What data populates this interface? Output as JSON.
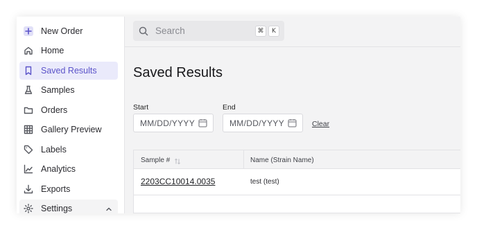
{
  "sidebar": {
    "items": [
      {
        "label": "New Order",
        "icon": "plus-icon"
      },
      {
        "label": "Home",
        "icon": "home-icon"
      },
      {
        "label": "Saved Results",
        "icon": "bookmark-icon",
        "active": true
      },
      {
        "label": "Samples",
        "icon": "flask-icon"
      },
      {
        "label": "Orders",
        "icon": "folder-icon"
      },
      {
        "label": "Gallery Preview",
        "icon": "grid-icon"
      },
      {
        "label": "Labels",
        "icon": "tag-icon"
      },
      {
        "label": "Analytics",
        "icon": "chart-icon"
      },
      {
        "label": "Exports",
        "icon": "download-icon"
      },
      {
        "label": "Settings",
        "icon": "gear-icon",
        "expanded": true
      }
    ]
  },
  "search": {
    "placeholder": "Search",
    "shortcut_mod": "⌘",
    "shortcut_key": "K"
  },
  "main": {
    "title": "Saved Results",
    "filters": {
      "start_label": "Start",
      "end_label": "End",
      "date_placeholder": "MM/DD/YYYY",
      "clear_label": "Clear"
    },
    "table": {
      "columns": [
        "Sample #",
        "Name (Strain Name)"
      ],
      "rows": [
        {
          "sample": "2203CC10014.0035",
          "name": "test (test)"
        }
      ]
    }
  },
  "colors": {
    "accent": "#5b53c9",
    "active_bg": "#eaeafb",
    "main_bg": "#f3f3f4"
  }
}
